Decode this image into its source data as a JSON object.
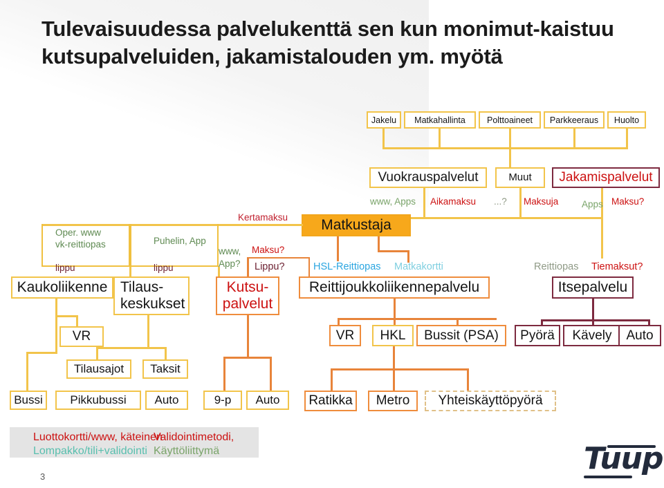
{
  "slide": {
    "title": "Tulevaisuudessa palvelukenttä sen kun monimut-kaistuu kutsupalveluiden, jakamistalouden ym. myötä",
    "number": "3",
    "logo_text": "Tuup"
  },
  "top_row": [
    {
      "label": "Jakelu"
    },
    {
      "label": "Matkahallinta"
    },
    {
      "label": "Polttoaineet"
    },
    {
      "label": "Parkkeeraus"
    },
    {
      "label": "Huolto"
    }
  ],
  "service_row": [
    {
      "label": "Vuokrauspalvelut"
    },
    {
      "label": "Muut"
    },
    {
      "label": "Jakamispalvelut"
    }
  ],
  "channel_labels": {
    "www_apps": "www, Apps",
    "aikamaksu": "Aikamaksu",
    "unknown": "...?",
    "maksuja": "Maksuja",
    "apps": "Apps",
    "maksu_q": "Maksu?",
    "kertamaksu": "Kertamaksu",
    "oper_www": "Oper. www",
    "vk_reittiopas": "vk-reittiopas",
    "puhelin_app": "Puhelin, App",
    "lippu_left": "lippu",
    "lippu_mid": "lippu",
    "www_app_q": "www,",
    "app_q": "App?",
    "maksu_q2": "Maksu?",
    "lippu_q": "Lippu?",
    "hsl_reittiopas": "HSL-Reittiopas",
    "matkakortti": "Matkakortti",
    "reittiopas": "Reittiopas",
    "tiemaksut": "Tiemaksut?"
  },
  "traveler": {
    "label": "Matkustaja"
  },
  "main_row": [
    {
      "label": "Kaukoliikenne"
    },
    {
      "label": "Tilaus-\nkeskukset"
    },
    {
      "label": "Kutsu-\npalvelut"
    },
    {
      "label": "Reittijoukkoliikennepalvelu"
    },
    {
      "label": "Itsepalvelu"
    }
  ],
  "mid_row": {
    "vr_left": "VR",
    "vr": "VR",
    "hkl": "HKL",
    "bussit_psa": "Bussit (PSA)",
    "pyora": "Pyörä",
    "kavely": "Kävely",
    "auto_self": "Auto"
  },
  "sub_row": {
    "tilausajot": "Tilausajot",
    "taksit": "Taksit"
  },
  "bottom_row": {
    "bussi": "Bussi",
    "pikkubussi": "Pikkubussi",
    "auto": "Auto",
    "nine_p": "9-p",
    "auto2": "Auto",
    "ratikka": "Ratikka",
    "metro": "Metro",
    "yhteiskayttopyora": "Yhteiskäyttöpyörä"
  },
  "footer": {
    "line1_red": "Luottokortti/www, käteinen",
    "line1_red2": "Validointimetodi,",
    "line2_teal": "Lompakko/tili+validointi",
    "line2_green": "Käyttöliittymä"
  },
  "colors": {
    "yellow": "#f2c44a",
    "orange": "#e8843a",
    "maroon": "#7d2a3f",
    "red": "#cc1111",
    "green": "#7aa46a",
    "blue": "#2aa5e0",
    "teal": "#58bfae",
    "fill_orange": "#f7a81b",
    "logo_navy": "#232b3c"
  }
}
